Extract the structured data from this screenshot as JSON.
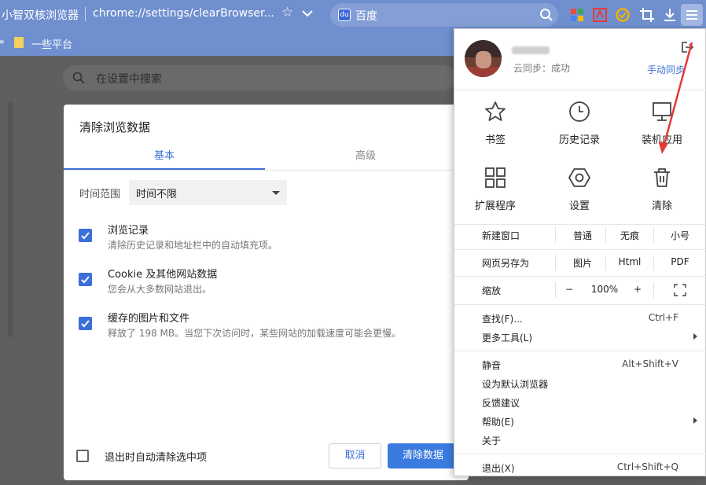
{
  "browser": {
    "app_name": "小智双核浏览器",
    "url": "chrome://settings/clearBrowser...",
    "search_engine": "百度",
    "bookmark": "一些平台"
  },
  "settings": {
    "search_placeholder": "在设置中搜索"
  },
  "dialog": {
    "title": "清除浏览数据",
    "tabs": [
      "基本",
      "高级"
    ],
    "time_range_label": "时间范围",
    "time_range_value": "时间不限",
    "options": [
      {
        "title": "浏览记录",
        "desc": "清除历史记录和地址栏中的自动填充项。",
        "checked": true
      },
      {
        "title": "Cookie 及其他网站数据",
        "desc": "您会从大多数网站退出。",
        "checked": true
      },
      {
        "title": "缓存的图片和文件",
        "desc": "释放了 198 MB。当您下次访问时，某些网站的加载速度可能会更慢。",
        "checked": true
      }
    ],
    "auto_clear_label": "退出时自动清除选中项",
    "cancel": "取消",
    "clear": "清除数据"
  },
  "menu": {
    "sync_status": "云同步：成功",
    "manual_sync": "手动同步",
    "grid": [
      "书签",
      "历史记录",
      "装机应用",
      "扩展程序",
      "设置",
      "清除"
    ],
    "new_window": {
      "label": "新建窗口",
      "options": [
        "普通",
        "无痕",
        "小号"
      ]
    },
    "save_page": {
      "label": "网页另存为",
      "options": [
        "图片",
        "Html",
        "PDF"
      ]
    },
    "zoom": {
      "label": "缩放",
      "minus": "−",
      "value": "100%",
      "plus": "+"
    },
    "find": {
      "label": "查找(F)...",
      "shortcut": "Ctrl+F"
    },
    "more_tools": "更多工具(L)",
    "mute": {
      "label": "静音",
      "shortcut": "Alt+Shift+V"
    },
    "set_default": "设为默认浏览器",
    "feedback": "反馈建议",
    "help": "帮助(E)",
    "about": "关于",
    "quit": {
      "label": "退出(X)",
      "shortcut": "Ctrl+Shift+Q"
    }
  },
  "colors": {
    "accent": "#3b6fd9",
    "toolbar": "#6f8fcf",
    "annotation": "#e53935"
  }
}
